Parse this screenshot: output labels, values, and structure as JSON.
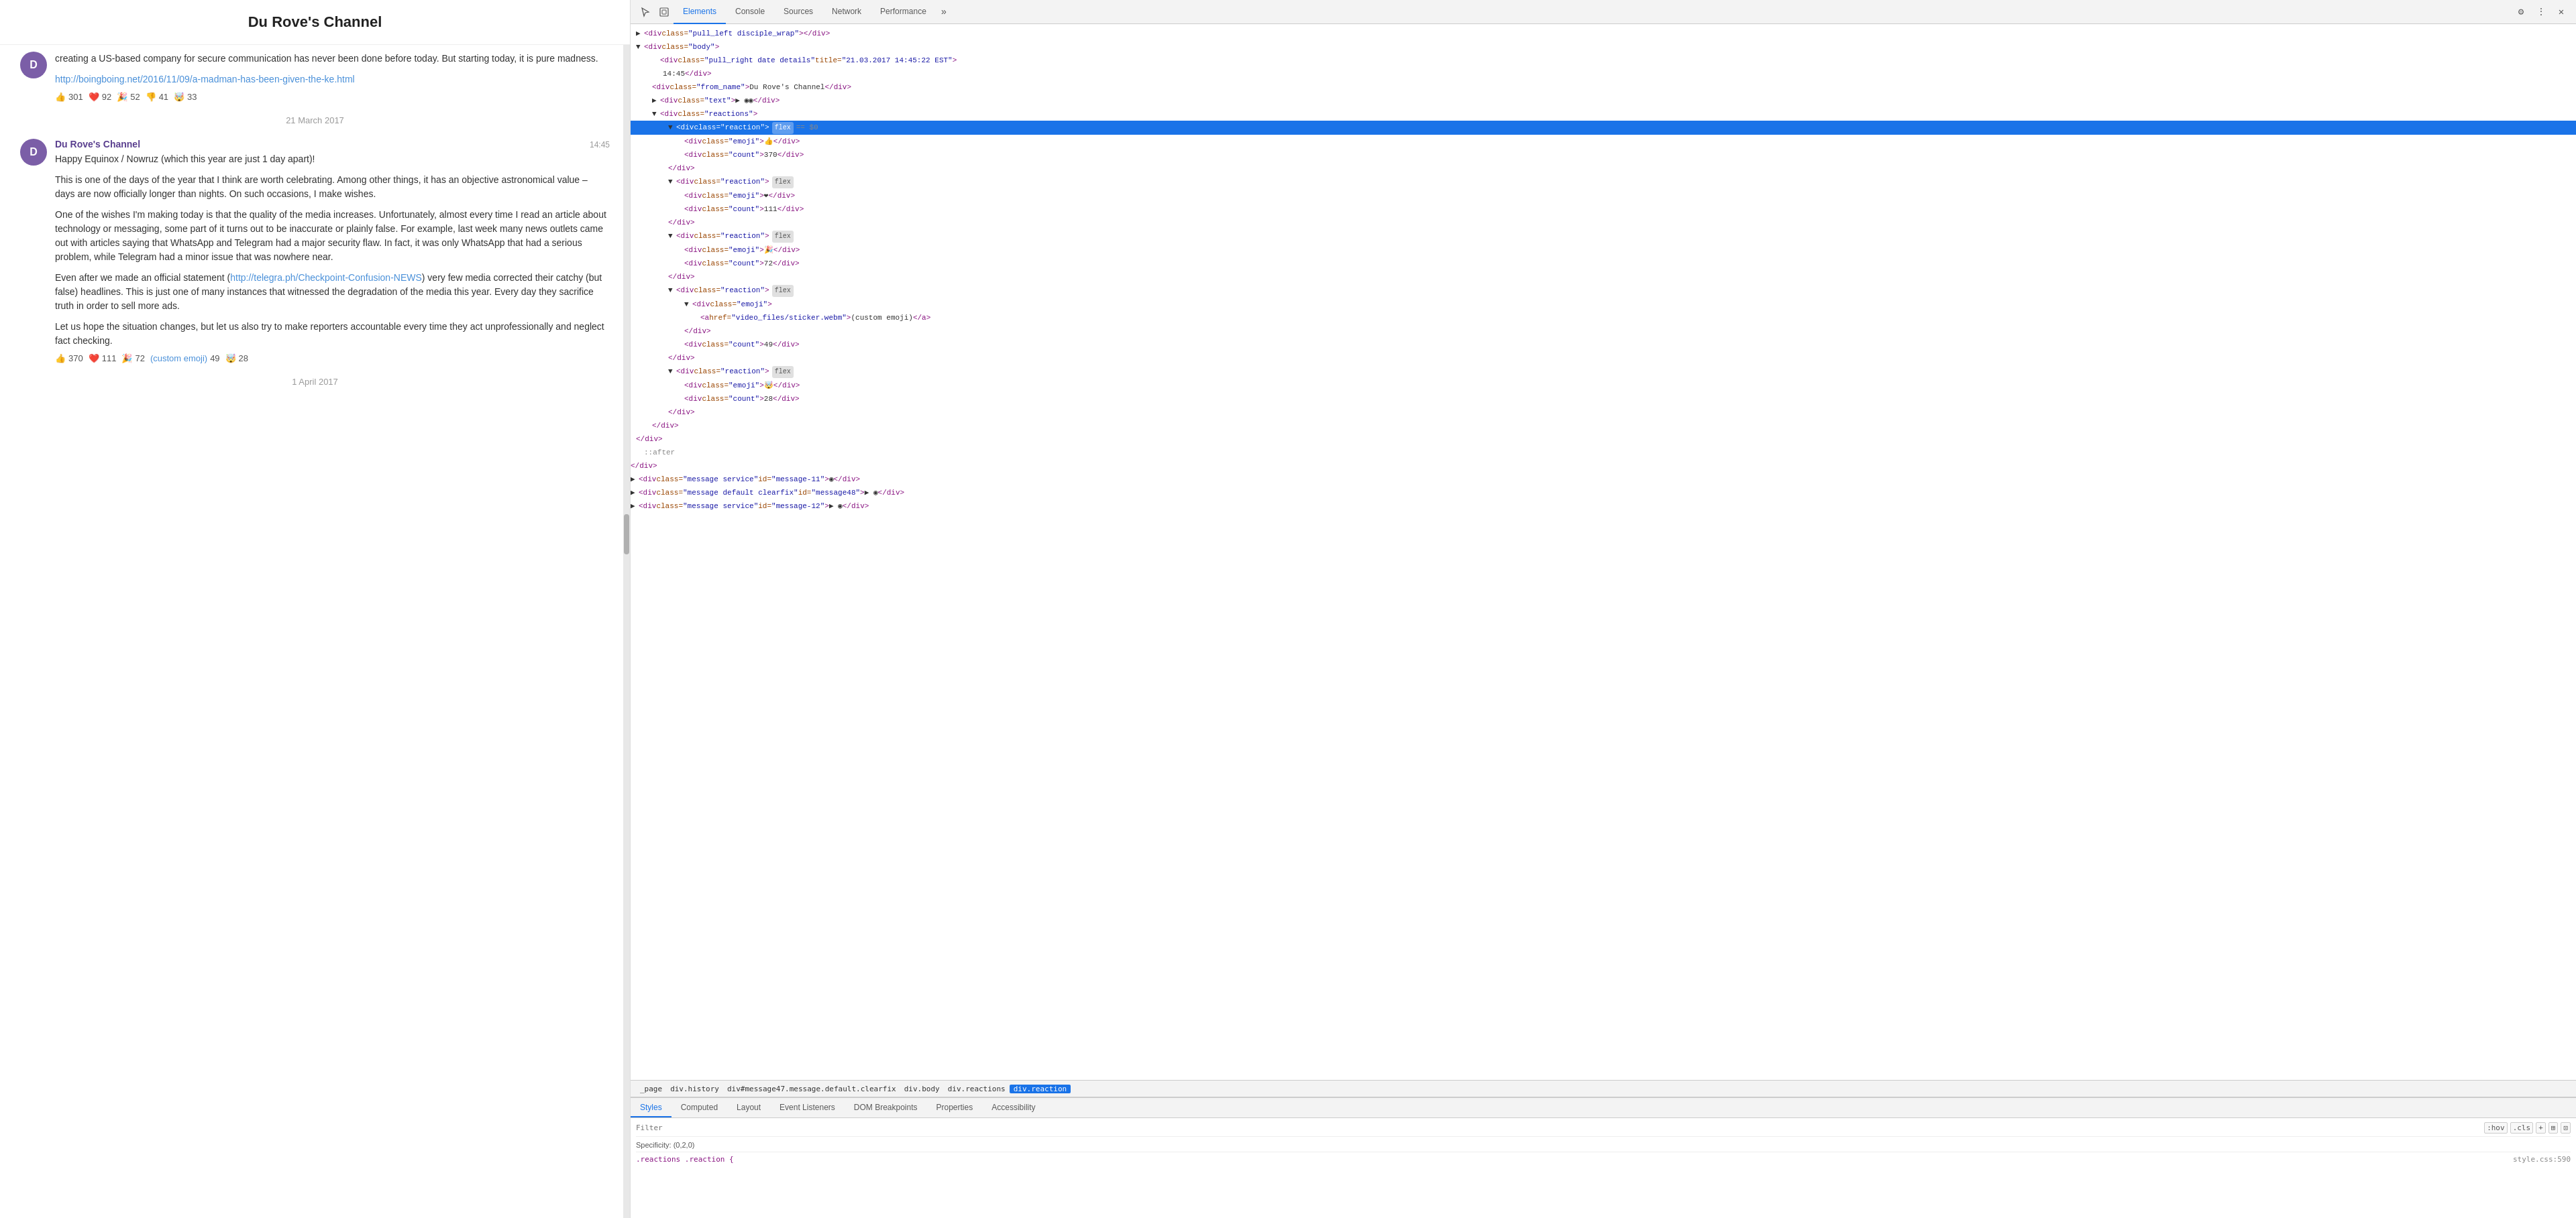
{
  "chat": {
    "title": "Du Rove's Channel",
    "messages": [
      {
        "id": "msg-prev",
        "avatar_letter": "D",
        "sender": "Du Rove's Channel",
        "timestamp": "",
        "paragraphs": [
          "creating a US-based company for secure communication has never been done before today. But starting today, it is pure madness."
        ],
        "link": "http://boingboing.net/2016/11/09/a-madman-has-been-given-the-ke.html",
        "reactions": [
          {
            "emoji": "👍",
            "count": "301"
          },
          {
            "emoji": "❤️",
            "count": "92"
          },
          {
            "emoji": "🎉",
            "count": "52"
          },
          {
            "emoji": "👎",
            "count": "41"
          },
          {
            "emoji": "🤯",
            "count": "33"
          }
        ],
        "date_after": "21 March 2017"
      },
      {
        "id": "msg-main",
        "avatar_letter": "D",
        "sender": "Du Rove's Channel",
        "timestamp": "14:45",
        "paragraphs": [
          "Happy Equinox / Nowruz (which this year are just 1 day apart)!",
          "This is one of the days of the year that I think are worth celebrating. Among other things, it has an objective astronomical value – days are now officially longer than nights. On such occasions, I make wishes.",
          "One of the wishes I'm making today is that the quality of the media increases. Unfortunately, almost every time I read an article about technology or messaging, some part of it turns out to be inaccurate or plainly false. For example, last week many news outlets came out with articles saying that WhatsApp and Telegram had a major security flaw. In fact, it was only WhatsApp that had a serious problem, while Telegram had a minor issue that was nowhere near.",
          "Even after we made an official statement (http://telegra.ph/Checkpoint-Confusion-NEWS) very few media corrected their catchy (but false) headlines. This is just one of many instances that witnessed the degradation of the media this year. Every day they sacrifice truth in order to sell more ads.",
          "Let us hope the situation changes, but let us also try to make reporters accountable every time they act unprofessionally and neglect fact checking."
        ],
        "reactions": [
          {
            "emoji": "👍",
            "count": "370"
          },
          {
            "emoji": "❤️",
            "count": "111"
          },
          {
            "emoji": "🎉",
            "count": "72"
          },
          {
            "emoji": "(custom emoji)",
            "count": "49",
            "is_custom": true
          },
          {
            "emoji": "🤯",
            "count": "28"
          }
        ],
        "date_after": "1 April 2017"
      }
    ]
  },
  "devtools": {
    "toolbar_icons": [
      "cursor-icon",
      "inspect-icon"
    ],
    "tabs": [
      {
        "label": "Elements",
        "active": true
      },
      {
        "label": "Console",
        "active": false
      },
      {
        "label": "Sources",
        "active": false
      },
      {
        "label": "Network",
        "active": false
      },
      {
        "label": "Performance",
        "active": false
      }
    ],
    "more_tabs_icon": "»",
    "settings_icon": "⚙",
    "more_icon": "⋮",
    "close_icon": "✕",
    "html_lines": [
      {
        "indent": 2,
        "content": "<div class=\"pull_left disciple_wrap\"> </div>",
        "has_toggle": true,
        "collapsed": true
      },
      {
        "indent": 2,
        "content": "<div class=\"body\">",
        "has_toggle": true,
        "collapsed": false
      },
      {
        "indent": 4,
        "content": "<div class=\"pull_right date details\" title=\"21.03.2017 14:45:22 EST\">",
        "has_toggle": false
      },
      {
        "indent": 4,
        "content": "14:45 </div>"
      },
      {
        "indent": 4,
        "content": "<div class=\"from_name\"> Du Rove's Channel </div>"
      },
      {
        "indent": 4,
        "content": "<div class=\"text\">▶ ◉◉ </div>",
        "has_toggle": true
      },
      {
        "indent": 4,
        "content": "<div class=\"reactions\">",
        "selected": true,
        "has_toggle": true
      },
      {
        "indent": 6,
        "content": "<div class=\"reaction\"> (flex) == $0",
        "selected": true,
        "has_badge": true,
        "badge": "flex",
        "dollar": "== $0"
      },
      {
        "indent": 8,
        "content": "<div class=\"emoji\"> 👍 </div>"
      },
      {
        "indent": 8,
        "content": "<div class=\"count\"> 370 </div>"
      },
      {
        "indent": 6,
        "content": "</div>"
      },
      {
        "indent": 6,
        "content": "<div class=\"reaction\"> (flex)",
        "has_badge": true,
        "badge": "flex"
      },
      {
        "indent": 8,
        "content": "<div class=\"emoji\"> ❤ </div>"
      },
      {
        "indent": 8,
        "content": "<div class=\"count\"> 111 </div>"
      },
      {
        "indent": 6,
        "content": "</div>"
      },
      {
        "indent": 6,
        "content": "<div class=\"reaction\"> (flex)",
        "has_badge": true,
        "badge": "flex"
      },
      {
        "indent": 8,
        "content": "<div class=\"emoji\"> 🎉 </div>"
      },
      {
        "indent": 8,
        "content": "<div class=\"count\"> 72 </div>"
      },
      {
        "indent": 6,
        "content": "</div>"
      },
      {
        "indent": 6,
        "content": "<div class=\"reaction\"> (flex)",
        "has_badge": true,
        "badge": "flex"
      },
      {
        "indent": 8,
        "content": "<div class=\"emoji\">"
      },
      {
        "indent": 10,
        "content": "<a href=\"video_files/sticker.webm\">(custom emoji)</a>"
      },
      {
        "indent": 8,
        "content": "</div>"
      },
      {
        "indent": 8,
        "content": "<div class=\"count\"> 49 </div>"
      },
      {
        "indent": 6,
        "content": "</div>"
      },
      {
        "indent": 6,
        "content": "<div class=\"reaction\"> (flex)",
        "has_badge": true,
        "badge": "flex"
      },
      {
        "indent": 8,
        "content": "<div class=\"emoji\"> 🤯 </div>"
      },
      {
        "indent": 8,
        "content": "<div class=\"count\"> 28 </div>"
      },
      {
        "indent": 6,
        "content": "</div>"
      },
      {
        "indent": 4,
        "content": "</div>"
      },
      {
        "indent": 2,
        "content": "</div>"
      },
      {
        "indent": 2,
        "content": "::after",
        "is_pseudo": true
      },
      {
        "indent": 0,
        "content": "</div>"
      },
      {
        "indent": 0,
        "content": "<div class=\"message service\" id=\"message-11\">◉ </div>",
        "has_toggle": true,
        "collapsed": true
      },
      {
        "indent": 0,
        "content": "<div class=\"message default clearfix\" id=\"message48\">▶ ◉ </div>",
        "has_toggle": true,
        "collapsed": true
      },
      {
        "indent": 0,
        "content": "<div class=\"message service\" id=\"message-12\">▶ ◉ </div>",
        "has_toggle": true,
        "collapsed": true
      }
    ],
    "breadcrumb": [
      {
        "label": "_page",
        "active": false
      },
      {
        "label": "div.history",
        "active": false
      },
      {
        "label": "div#message47.message.default.clearfix",
        "active": false
      },
      {
        "label": "div.body",
        "active": false
      },
      {
        "label": "div.reactions",
        "active": false
      },
      {
        "label": "div.reaction",
        "active": true
      }
    ],
    "bottom_tabs": [
      {
        "label": "Styles",
        "active": true
      },
      {
        "label": "Computed",
        "active": false
      },
      {
        "label": "Layout",
        "active": false
      },
      {
        "label": "Event Listeners",
        "active": false
      },
      {
        "label": "DOM Breakpoints",
        "active": false
      },
      {
        "label": "Properties",
        "active": false
      },
      {
        "label": "Accessibility",
        "active": false
      }
    ],
    "filter_placeholder": "Filter",
    "filter_buttons": [
      ":hov",
      ".cls",
      "+",
      "⊞",
      "⊡"
    ],
    "specificity": "Specificity: (0,2,0)",
    "css_rules": [
      {
        "selector": ".reactions .reaction {",
        "source": "style.css:590"
      }
    ]
  }
}
